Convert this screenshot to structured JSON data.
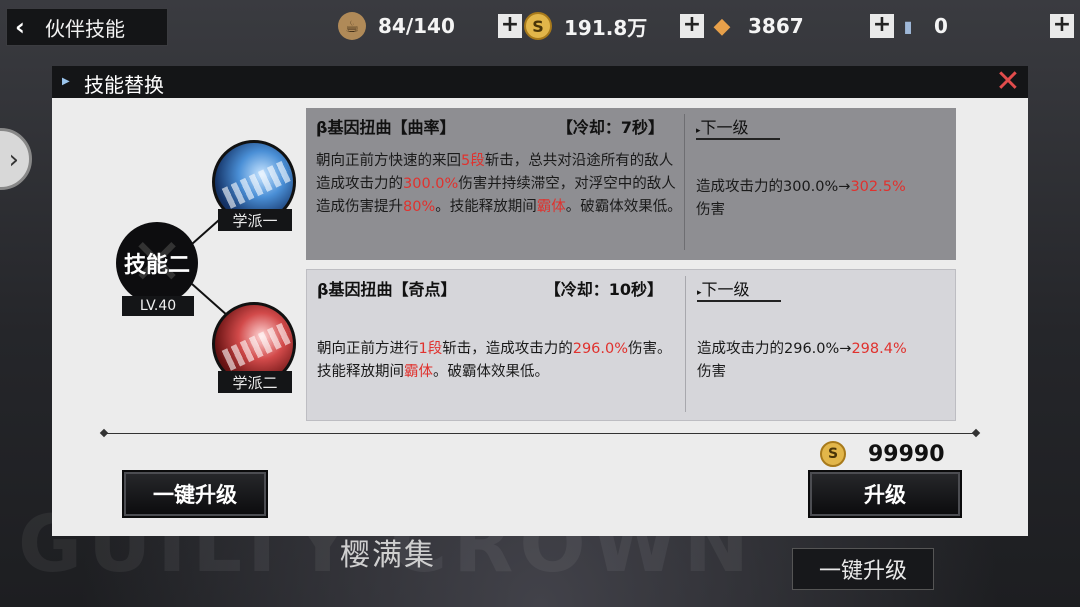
{
  "topbar": {
    "back_title": "伙伴技能",
    "resources": [
      {
        "icon": "stamina-cup-icon",
        "value": "84/140"
      },
      {
        "icon": "coin-icon",
        "value": "191.8万"
      },
      {
        "icon": "gem-icon",
        "value": "3867"
      },
      {
        "icon": "ticket-icon",
        "value": "0"
      }
    ]
  },
  "background": {
    "watermark": "GUILTY CROWN",
    "character_name": "樱满集",
    "upgrade_all_label": "一键升级"
  },
  "modal": {
    "title": "技能替换",
    "skill": {
      "name": "技能二",
      "level": "LV.40"
    },
    "schools": [
      {
        "label": "学派一",
        "color": "#3f7fd0"
      },
      {
        "label": "学派二",
        "color": "#c83a3a"
      }
    ],
    "cards": [
      {
        "name": "β基因扭曲【曲率】",
        "cooldown": "【冷却：7秒】",
        "desc_parts": [
          "朝向正前方快速的来回",
          "5段",
          "斩击，总共对沿途所有的敌人造成攻击力的",
          "300.0%",
          "伤害并持续滞空，对浮空中的敌人造成伤害提升",
          "80%",
          "。技能释放期间",
          "霸体",
          "。破霸体效果低。"
        ],
        "next_title": "下一级",
        "next_parts": [
          "造成攻击力的300.0%→",
          "302.5%",
          "伤害"
        ]
      },
      {
        "name": "β基因扭曲【奇点】",
        "cooldown": "【冷却：10秒】",
        "desc_parts": [
          "朝向正前方进行",
          "1段",
          "斩击，造成攻击力的",
          "296.0%",
          "伤害。技能释放期间",
          "霸体",
          "。破霸体效果低。"
        ],
        "next_title": "下一级",
        "next_parts": [
          "造成攻击力的296.0%→",
          "298.4%",
          "伤害"
        ]
      }
    ],
    "cost": "99990",
    "upgrade_all_label": "一键升级",
    "upgrade_label": "升级",
    "highlight_color": "#e0322e"
  }
}
